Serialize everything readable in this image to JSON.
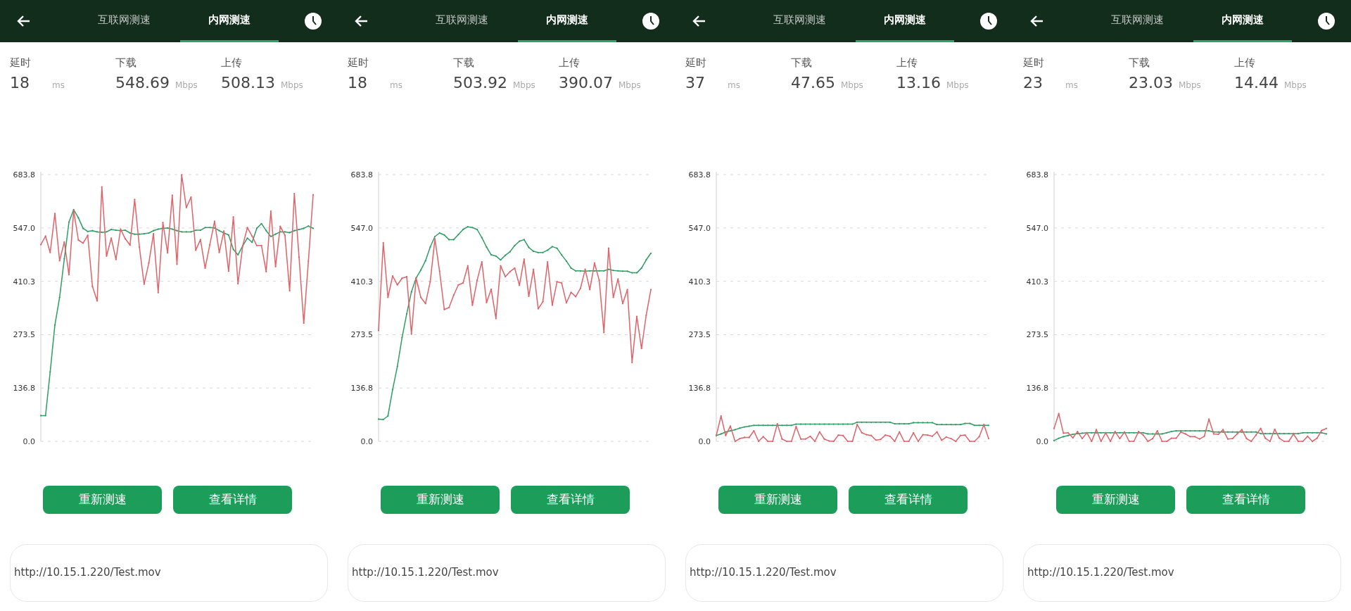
{
  "panels": [
    {
      "tabs": [
        {
          "label": "互联网测速",
          "selected": false
        },
        {
          "label": "内网测速",
          "selected": true
        }
      ],
      "stats": [
        {
          "label": "延时",
          "value": "18",
          "unit": "ms"
        },
        {
          "label": "下载",
          "value": "548.69",
          "unit": "Mbps"
        },
        {
          "label": "上传",
          "value": "508.13",
          "unit": "Mbps"
        }
      ],
      "chart_data": {
        "type": "line",
        "grid": true,
        "ylim": [
          0,
          683.8
        ],
        "yticks": [
          {
            "value": 0,
            "label": "0.0"
          },
          {
            "value": 136.8,
            "label": "136.8"
          },
          {
            "value": 273.5,
            "label": "273.5"
          },
          {
            "value": 410.3,
            "label": "410.3"
          },
          {
            "value": 547,
            "label": "547.0"
          },
          {
            "value": 683.8,
            "label": "683.8"
          }
        ],
        "series": [
          {
            "color": "#2e9e63",
            "values": [
              66,
              66,
              178,
              298,
              369,
              468,
              562,
              594,
              573,
              546,
              538,
              540,
              537,
              536,
              537,
              543,
              541,
              540,
              541,
              534,
              531,
              531,
              532,
              534,
              540,
              544,
              546,
              547,
              544,
              540,
              537,
              537,
              537,
              541,
              541,
              548,
              548,
              547,
              540,
              534,
              529,
              492,
              478,
              501,
              521,
              510,
              546,
              558,
              540,
              525,
              531,
              537,
              537,
              535,
              540,
              543,
              546,
              552,
              546
            ]
          },
          {
            "color": "#df6369",
            "values": [
              504,
              526,
              484,
              584,
              463,
              511,
              427,
              591,
              516,
              508,
              528,
              397,
              360,
              652,
              475,
              521,
              466,
              544,
              519,
              503,
              620,
              498,
              403,
              457,
              532,
              381,
              561,
              483,
              631,
              454,
              683,
              599,
              626,
              490,
              517,
              444,
              504,
              564,
              484,
              539,
              436,
              575,
              404,
              501,
              548,
              526,
              502,
              502,
              435,
              590,
              448,
              551,
              528,
              386,
              635,
              472,
              303,
              462,
              632
            ]
          }
        ]
      },
      "buttons": [
        "重新测速",
        "查看详情"
      ],
      "url": "http://10.15.1.220/Test.mov"
    },
    {
      "tabs": [
        {
          "label": "互联网测速",
          "selected": false
        },
        {
          "label": "内网测速",
          "selected": true
        }
      ],
      "stats": [
        {
          "label": "延时",
          "value": "18",
          "unit": "ms"
        },
        {
          "label": "下载",
          "value": "503.92",
          "unit": "Mbps"
        },
        {
          "label": "上传",
          "value": "390.07",
          "unit": "Mbps"
        }
      ],
      "chart_data": {
        "type": "line",
        "grid": true,
        "ylim": [
          0,
          683.8
        ],
        "yticks": [
          {
            "value": 0,
            "label": "0.0"
          },
          {
            "value": 136.8,
            "label": "136.8"
          },
          {
            "value": 273.5,
            "label": "273.5"
          },
          {
            "value": 410.3,
            "label": "410.3"
          },
          {
            "value": 547,
            "label": "547.0"
          },
          {
            "value": 683.8,
            "label": "683.8"
          }
        ],
        "series": [
          {
            "color": "#2e9e63",
            "values": [
              57,
              56,
              65,
              133,
              192,
              266,
              327,
              383,
              419,
              439,
              463,
              498,
              525,
              534,
              529,
              517,
              517,
              530,
              543,
              550,
              548,
              543,
              522,
              498,
              478,
              475,
              465,
              477,
              486,
              502,
              513,
              517,
              497,
              487,
              484,
              484,
              490,
              499,
              495,
              478,
              462,
              444,
              437,
              437,
              436,
              437,
              437,
              437,
              437,
              441,
              438,
              437,
              436,
              436,
              432,
              432,
              444,
              465,
              482
            ]
          },
          {
            "color": "#df6369",
            "values": [
              284,
              509,
              369,
              424,
              401,
              418,
              422,
              275,
              418,
              369,
              353,
              409,
              519,
              436,
              338,
              343,
              375,
              401,
              406,
              450,
              349,
              413,
              460,
              356,
              390,
              315,
              450,
              422,
              435,
              444,
              400,
              467,
              372,
              441,
              340,
              358,
              460,
              349,
              409,
              406,
              355,
              382,
              371,
              392,
              441,
              389,
              457,
              413,
              279,
              495,
              369,
              416,
              353,
              389,
              202,
              320,
              238,
              323,
              389
            ]
          }
        ]
      },
      "buttons": [
        "重新测速",
        "查看详情"
      ],
      "url": "http://10.15.1.220/Test.mov"
    },
    {
      "tabs": [
        {
          "label": "互联网测速",
          "selected": false
        },
        {
          "label": "内网测速",
          "selected": true
        }
      ],
      "stats": [
        {
          "label": "延时",
          "value": "37",
          "unit": "ms"
        },
        {
          "label": "下载",
          "value": "47.65",
          "unit": "Mbps"
        },
        {
          "label": "上传",
          "value": "13.16",
          "unit": "Mbps"
        }
      ],
      "chart_data": {
        "type": "line",
        "grid": true,
        "ylim": [
          0,
          683.8
        ],
        "yticks": [
          {
            "value": 0,
            "label": "0.0"
          },
          {
            "value": 136.8,
            "label": "136.8"
          },
          {
            "value": 273.5,
            "label": "273.5"
          },
          {
            "value": 410.3,
            "label": "410.3"
          },
          {
            "value": 547,
            "label": "547.0"
          },
          {
            "value": 683.8,
            "label": "683.8"
          }
        ],
        "series": [
          {
            "color": "#2e9e63",
            "values": [
              15,
              19,
              24,
              27,
              30,
              34,
              37,
              39,
              41,
              41,
              41,
              41,
              41,
              41,
              41,
              41,
              41,
              44,
              44,
              44,
              44,
              44,
              44,
              44,
              44,
              44,
              44,
              44,
              44,
              44,
              49,
              49,
              49,
              49,
              49,
              49,
              49,
              49,
              45,
              45,
              45,
              45,
              48,
              48,
              48,
              48,
              48,
              43,
              43,
              43,
              43,
              43,
              43,
              46,
              46,
              41,
              41,
              41,
              41
            ]
          },
          {
            "color": "#df6369",
            "values": [
              15,
              65,
              15,
              39,
              0,
              7,
              10,
              10,
              27,
              0,
              12,
              0,
              0,
              45,
              6,
              0,
              0,
              38,
              6,
              6,
              13,
              0,
              24,
              6,
              1,
              0,
              16,
              15,
              0,
              0,
              43,
              22,
              17,
              15,
              3,
              5,
              16,
              13,
              0,
              24,
              0,
              0,
              22,
              0,
              17,
              16,
              13,
              24,
              3,
              11,
              7,
              0,
              15,
              16,
              0,
              0,
              12,
              43,
              7
            ]
          }
        ]
      },
      "buttons": [
        "重新测速",
        "查看详情"
      ],
      "url": "http://10.15.1.220/Test.mov"
    },
    {
      "tabs": [
        {
          "label": "互联网测速",
          "selected": false
        },
        {
          "label": "内网测速",
          "selected": true
        }
      ],
      "stats": [
        {
          "label": "延时",
          "value": "23",
          "unit": "ms"
        },
        {
          "label": "下载",
          "value": "23.03",
          "unit": "Mbps"
        },
        {
          "label": "上传",
          "value": "14.44",
          "unit": "Mbps"
        }
      ],
      "chart_data": {
        "type": "line",
        "grid": true,
        "ylim": [
          0,
          683.8
        ],
        "yticks": [
          {
            "value": 0,
            "label": "0.0"
          },
          {
            "value": 136.8,
            "label": "136.8"
          },
          {
            "value": 273.5,
            "label": "273.5"
          },
          {
            "value": 410.3,
            "label": "410.3"
          },
          {
            "value": 547,
            "label": "547.0"
          },
          {
            "value": 683.8,
            "label": "683.8"
          }
        ],
        "series": [
          {
            "color": "#2e9e63",
            "values": [
              2,
              8,
              12,
              15,
              18,
              20,
              21,
              22,
              22,
              22,
              22,
              22,
              22,
              22,
              22,
              22,
              22,
              22,
              22,
              22,
              19,
              19,
              19,
              19,
              22,
              25,
              27,
              27,
              27,
              27,
              27,
              27,
              27,
              27,
              24,
              24,
              24,
              24,
              24,
              24,
              24,
              24,
              24,
              24,
              20,
              20,
              20,
              20,
              20,
              20,
              20,
              20,
              20,
              22,
              22,
              22,
              22,
              22,
              19
            ]
          },
          {
            "color": "#df6369",
            "values": [
              33,
              71,
              21,
              22,
              9,
              25,
              7,
              22,
              0,
              30,
              0,
              22,
              0,
              25,
              7,
              24,
              0,
              0,
              25,
              16,
              0,
              7,
              27,
              0,
              0,
              8,
              8,
              24,
              19,
              12,
              12,
              6,
              13,
              57,
              19,
              18,
              30,
              6,
              7,
              19,
              30,
              7,
              0,
              16,
              33,
              8,
              0,
              31,
              8,
              0,
              0,
              19,
              0,
              0,
              13,
              0,
              8,
              28,
              33
            ]
          }
        ]
      },
      "buttons": [
        "重新测速",
        "查看详情"
      ],
      "url": "http://10.15.1.220/Test.mov"
    }
  ]
}
